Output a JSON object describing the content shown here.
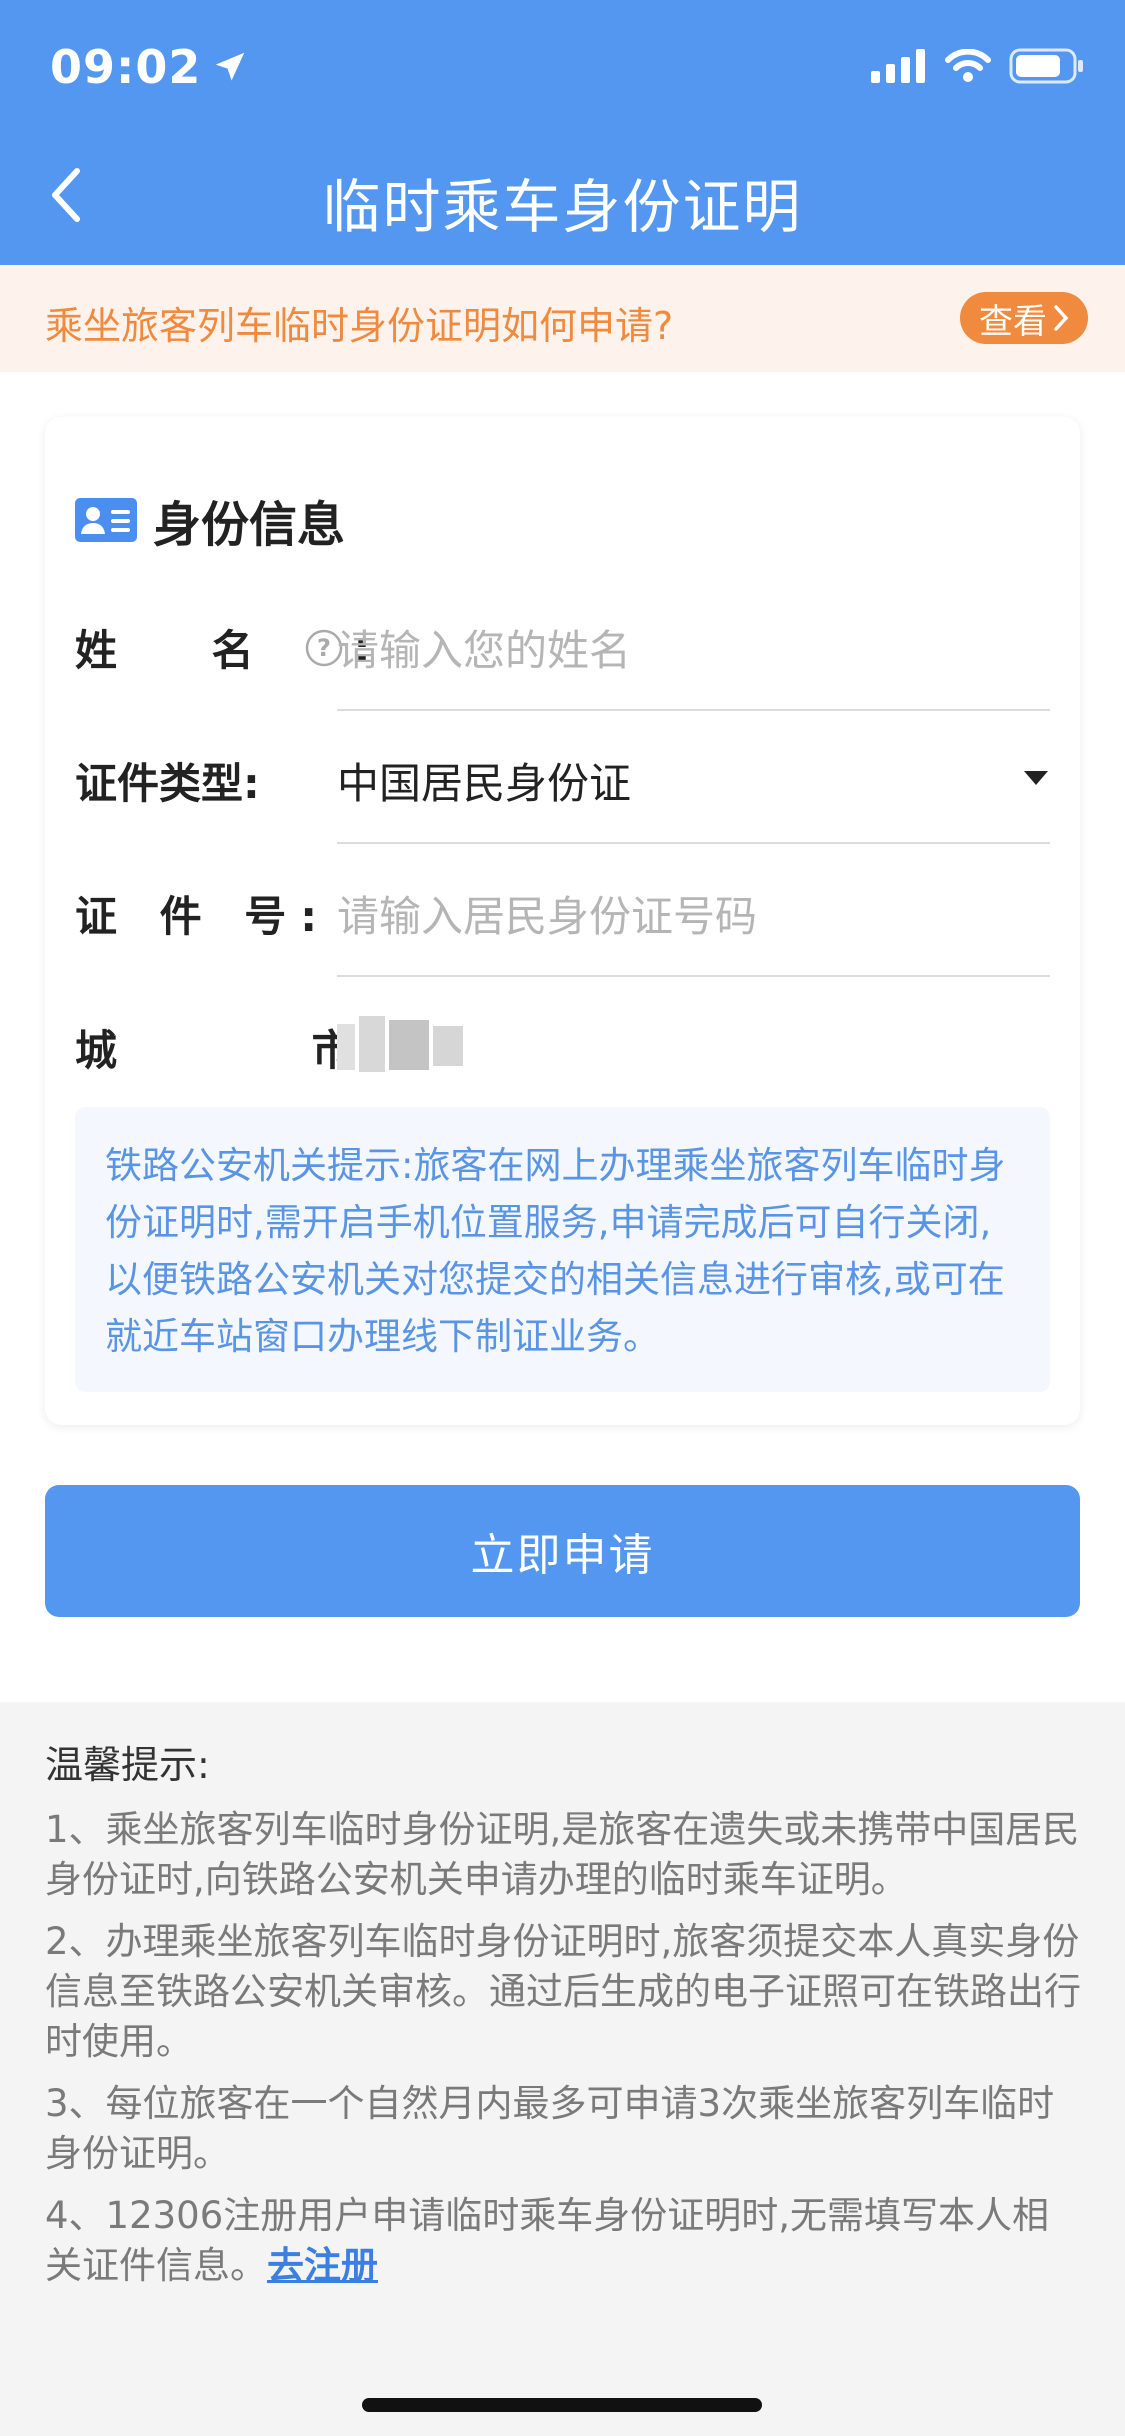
{
  "status": {
    "time": "09:02"
  },
  "header": {
    "title": "临时乘车身份证明"
  },
  "notice": {
    "text": "乘坐旅客列车临时身份证明如何申请?",
    "button": "查看"
  },
  "card": {
    "title": "身份信息",
    "fields": [
      {
        "label": "姓 名",
        "value": "",
        "placeholder": "请输入您的姓名"
      },
      {
        "label": "证件类型:",
        "value": "中国居民身份证"
      },
      {
        "label": "证 件 号:",
        "value": "",
        "placeholder": "请输入居民身份证号码"
      },
      {
        "label": "城 市:",
        "value": ""
      }
    ],
    "tip": "铁路公安机关提示:旅客在网上办理乘坐旅客列车临时身份证明时,需开启手机位置服务,申请完成后可自行关闭,以便铁路公安机关对您提交的相关信息进行审核,或可在就近车站窗口办理线下制证业务。"
  },
  "apply_button": "立即申请",
  "hints": {
    "title": "温馨提示:",
    "items": [
      "1、乘坐旅客列车临时身份证明,是旅客在遗失或未携带中国居民身份证时,向铁路公安机关申请办理的临时乘车证明。",
      "2、办理乘坐旅客列车临时身份证明时,旅客须提交本人真实身份信息至铁路公安机关审核。通过后生成的电子证照可在铁路出行时使用。",
      "3、每位旅客在一个自然月内最多可申请3次乘坐旅客列车临时身份证明。",
      "4、12306注册用户申请临时乘车身份证明时,无需填写本人相关证件信息。"
    ],
    "register_link": "去注册"
  },
  "colors": {
    "primary": "#5497f1",
    "notice_text": "#f08a3e",
    "tip_text": "#5a94e4"
  }
}
